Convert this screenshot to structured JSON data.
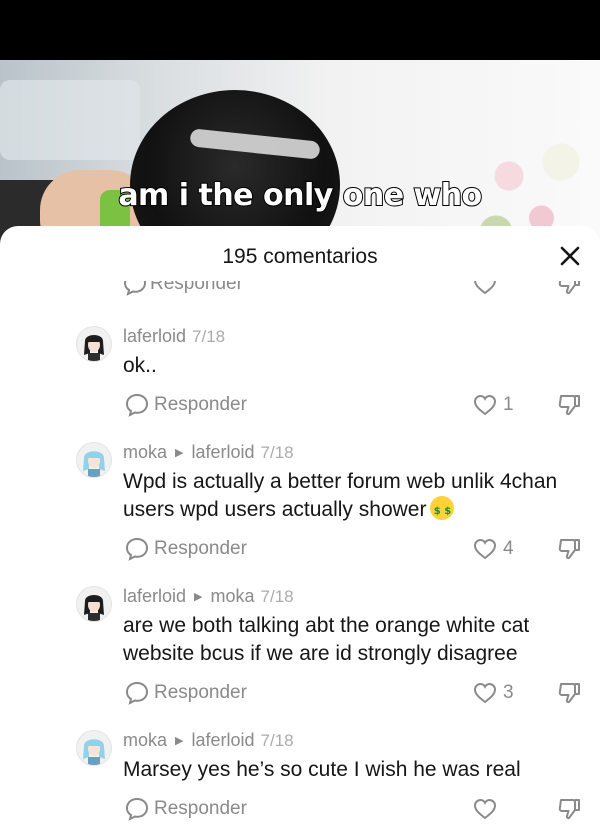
{
  "video": {
    "caption": "am i the only one who"
  },
  "sheet": {
    "title": "195 comentarios"
  },
  "partial_row": {
    "reply_label": "Responder"
  },
  "comments": [
    {
      "author": "laferloid",
      "reply_to": "",
      "date": "7/18",
      "text": "ok..",
      "likes": "1",
      "reply_label": "Responder",
      "avatar": "anime-girl-dark-hair"
    },
    {
      "author": "moka",
      "reply_to": "laferloid",
      "date": "7/18",
      "text": "Wpd is actually a better forum web unlik 4chan users wpd users actually shower",
      "emoji": "money-mouth-face-icon",
      "likes": "4",
      "reply_label": "Responder",
      "avatar": "anime-girl-blue-hair"
    },
    {
      "author": "laferloid",
      "reply_to": "moka",
      "date": "7/18",
      "text": "are we both talking abt the orange white cat website bcus if we are id strongly disagree",
      "likes": "3",
      "reply_label": "Responder",
      "avatar": "anime-girl-dark-hair"
    },
    {
      "author": "moka",
      "reply_to": "laferloid",
      "date": "7/18",
      "text": "Marsey yes he’s so cute I wish he was real",
      "likes": "",
      "reply_label": "Responder",
      "avatar": "anime-girl-blue-hair"
    }
  ],
  "icons": {
    "close": "close-icon",
    "reply": "speech-bubble-icon",
    "like": "heart-outline-icon",
    "dislike": "thumbs-down-icon"
  },
  "colors": {
    "text_primary": "#161616",
    "text_secondary": "#8a8a8a",
    "sheet_bg": "#ffffff",
    "caption_fill": "#ffffff",
    "caption_stroke": "#000000"
  }
}
